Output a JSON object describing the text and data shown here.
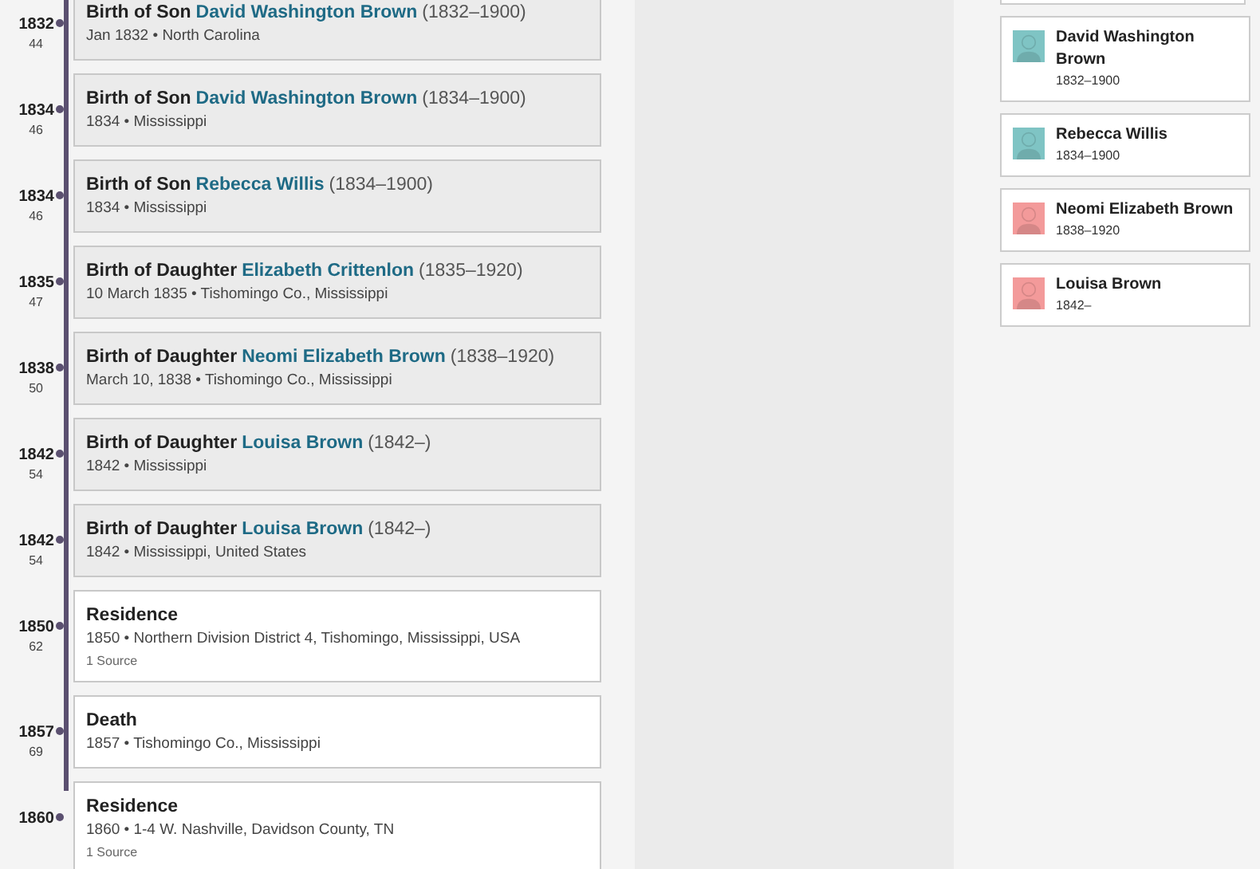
{
  "timeline": [
    {
      "year": "1832",
      "age": "44",
      "kind": "family",
      "title": "Birth of Son",
      "person": "David Washington Brown",
      "dates": "(1832–1900)",
      "detail": "Jan 1832 • North Carolina"
    },
    {
      "year": "1834",
      "age": "46",
      "kind": "family",
      "title": "Birth of Son",
      "person": "David Washington Brown",
      "dates": "(1834–1900)",
      "detail": "1834 • Mississippi"
    },
    {
      "year": "1834",
      "age": "46",
      "kind": "family",
      "title": "Birth of Son",
      "person": "Rebecca Willis",
      "dates": "(1834–1900)",
      "detail": "1834 • Mississippi"
    },
    {
      "year": "1835",
      "age": "47",
      "kind": "family",
      "title": "Birth of Daughter",
      "person": "Elizabeth Crittenlon",
      "dates": "(1835–1920)",
      "detail": "10 March 1835 • Tishomingo Co., Mississippi"
    },
    {
      "year": "1838",
      "age": "50",
      "kind": "family",
      "title": "Birth of Daughter",
      "person": "Neomi Elizabeth Brown",
      "dates": "(1838–1920)",
      "detail": "March 10, 1838 • Tishomingo Co., Mississippi"
    },
    {
      "year": "1842",
      "age": "54",
      "kind": "family",
      "title": "Birth of Daughter",
      "person": "Louisa Brown",
      "dates": "(1842–)",
      "detail": "1842 • Mississippi"
    },
    {
      "year": "1842",
      "age": "54",
      "kind": "family",
      "title": "Birth of Daughter",
      "person": "Louisa Brown",
      "dates": "(1842–)",
      "detail": "1842 • Mississippi, United States"
    },
    {
      "year": "1850",
      "age": "62",
      "kind": "personal",
      "title": "Residence",
      "detail": "1850 • Northern Division District 4, Tishomingo, Mississippi, USA",
      "sources": "1 Source"
    },
    {
      "year": "1857",
      "age": "69",
      "kind": "personal",
      "title": "Death",
      "detail": "1857 • Tishomingo Co., Mississippi"
    },
    {
      "year": "1860",
      "kind": "personal",
      "title": "Residence",
      "detail": "1860 • 1-4 W. Nashville, Davidson County, TN",
      "sources": "1 Source"
    }
  ],
  "family": [
    {
      "name": "David Washington Brown",
      "dates": "1832–1900",
      "color": "#7fc4c4"
    },
    {
      "name": "Rebecca Willis",
      "dates": "1834–1900",
      "color": "#7fc4c4"
    },
    {
      "name": "Neomi Elizabeth Brown",
      "dates": "1838–1920",
      "color": "#f39a9a"
    },
    {
      "name": "Louisa Brown",
      "dates": "1842–",
      "color": "#f39a9a"
    }
  ]
}
